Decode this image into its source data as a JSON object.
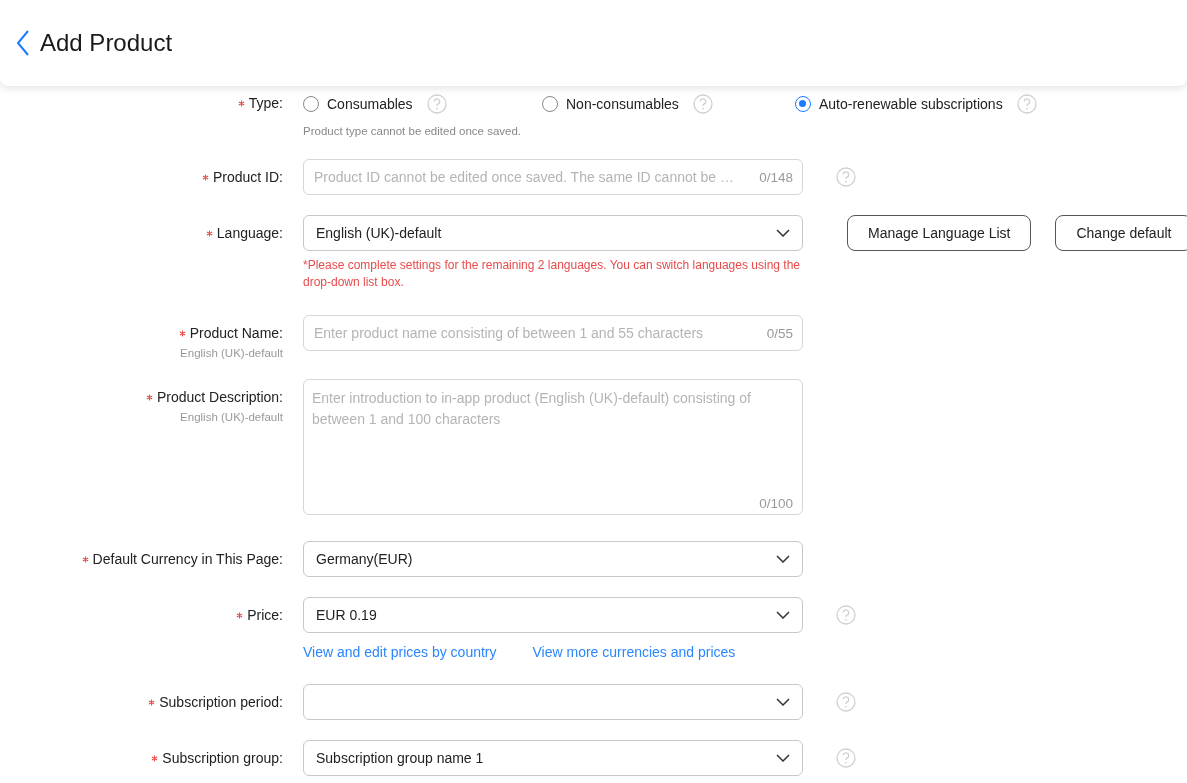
{
  "header": {
    "title": "Add Product"
  },
  "fields": [
    {
      "kind": "radio",
      "label": "Type:",
      "required": true,
      "options": [
        {
          "label": "Consumables",
          "selected": false,
          "help": true
        },
        {
          "label": "Non-consumables",
          "selected": false,
          "help": true
        },
        {
          "label": "Auto-renewable subscriptions",
          "selected": true,
          "help": true
        }
      ],
      "note": "Product type cannot be edited once saved."
    },
    {
      "kind": "input",
      "label": "Product ID:",
      "required": true,
      "placeholder": "Product ID cannot be edited once saved. The same ID cannot be …",
      "counter": "0/148",
      "help": true
    },
    {
      "kind": "select",
      "label": "Language:",
      "required": true,
      "value": "English (UK)-default",
      "buttons": [
        "Manage Language List",
        "Change default"
      ],
      "error": "*Please complete settings for the remaining 2 languages. You can switch languages using the drop-down list box."
    },
    {
      "kind": "input",
      "label": "Product Name:",
      "required": true,
      "sublabel": "English (UK)-default",
      "placeholder": "Enter product name consisting of between 1 and 55 characters",
      "counter": "0/55"
    },
    {
      "kind": "textarea",
      "label": "Product Description:",
      "required": true,
      "sublabel": "English (UK)-default",
      "placeholder": "Enter introduction to in-app product (English (UK)-default) consisting of between 1 and 100 characters",
      "counter": "0/100"
    },
    {
      "kind": "select",
      "label": "Default Currency in This Page:",
      "required": true,
      "value": "Germany(EUR)"
    },
    {
      "kind": "select",
      "label": "Price:",
      "required": true,
      "value": "EUR 0.19",
      "help": true,
      "links": [
        "View and edit prices by country",
        "View more currencies and prices"
      ]
    },
    {
      "kind": "select",
      "label": "Subscription period:",
      "required": true,
      "help": true
    },
    {
      "kind": "select",
      "label": "Subscription group:",
      "required": true,
      "value": "Subscription group name 1",
      "help": true
    }
  ]
}
